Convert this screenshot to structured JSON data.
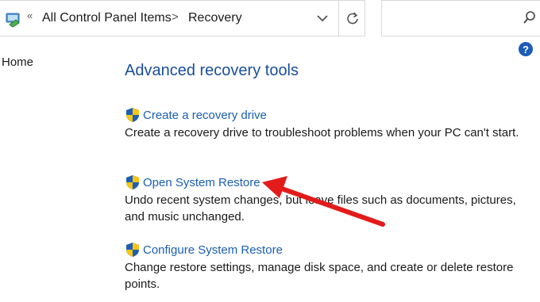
{
  "address_bar": {
    "back_chevron": "«",
    "breadcrumb": [
      "All Control Panel Items",
      "Recovery"
    ],
    "separator": ">"
  },
  "search": {
    "placeholder": ""
  },
  "help_label": "?",
  "sidebar": {
    "home_label": "Home"
  },
  "main": {
    "title": "Advanced recovery tools",
    "tools": [
      {
        "link": "Create a recovery drive",
        "desc": "Create a recovery drive to troubleshoot problems when your PC can't start."
      },
      {
        "link": "Open System Restore",
        "desc": "Undo recent system changes, but leave files such as documents, pictures, and music unchanged."
      },
      {
        "link": "Configure System Restore",
        "desc": "Change restore settings, manage disk space, and create or delete restore points."
      }
    ]
  },
  "icons": {
    "nav": "control-panel-icon",
    "dropdown": "chevron-down-icon",
    "refresh": "refresh-icon",
    "search": "search-icon",
    "help": "help-icon",
    "shield": "uac-shield-icon"
  },
  "colors": {
    "title": "#1a4e9c",
    "link": "#1a5fb4",
    "annotation_arrow": "#e31b1b",
    "help_bg": "#1c5bb8"
  }
}
